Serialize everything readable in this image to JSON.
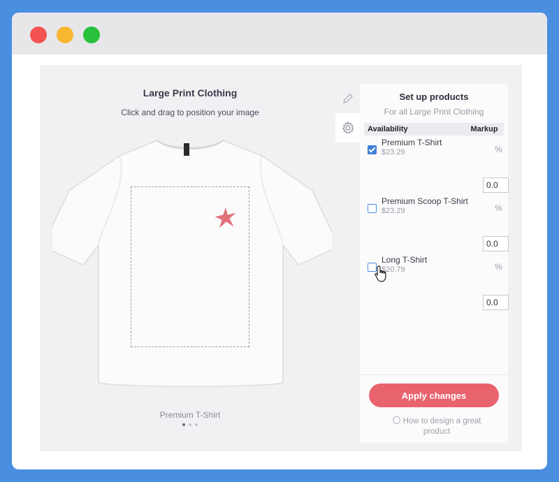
{
  "designer": {
    "title": "Large Print Clothing",
    "subtitle": "Click and drag to position your image",
    "product_name": "Premium T-Shirt",
    "carousel_active_index": 0,
    "carousel_count": 3
  },
  "side_tabs": [
    {
      "icon": "pencil-icon",
      "active": false
    },
    {
      "icon": "gear-icon",
      "active": true
    }
  ],
  "panel": {
    "title": "Set up products",
    "subtitle": "For all Large Print Clothing",
    "columns": {
      "availability": "Availability",
      "markup": "Markup"
    },
    "products": [
      {
        "name": "Premium T-Shirt",
        "price": "$23.29",
        "checked": true,
        "markup_value": "0.0",
        "unit": "%"
      },
      {
        "name": "Premium Scoop T-Shirt",
        "price": "$23.29",
        "checked": false,
        "markup_value": "0.0",
        "unit": "%"
      },
      {
        "name": "Long T-Shirt",
        "price": "$20.79",
        "checked": false,
        "markup_value": "0.0",
        "unit": "%"
      }
    ],
    "apply_label": "Apply changes",
    "help_text": "How to design a great product"
  },
  "colors": {
    "background": "#4a8ee0",
    "apply_button": "#e9636f",
    "checkbox": "#3f7fd8",
    "print_graphic": "#e0707a"
  }
}
